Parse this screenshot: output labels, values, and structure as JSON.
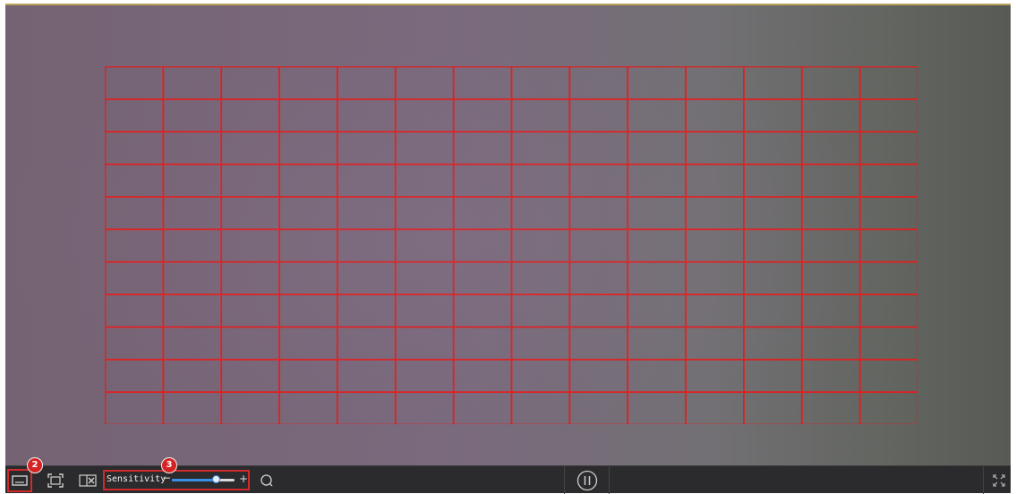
{
  "video": {
    "grid_rows": 11,
    "grid_cols": 14,
    "grid_color": "#e02020"
  },
  "toolbar": {
    "draw_area_tool": {
      "icon": "draw-rectangle-icon",
      "badge": "2"
    },
    "full_screen_area_tool": {
      "icon": "select-all-area-icon"
    },
    "clear_area_tool": {
      "icon": "clear-area-icon"
    },
    "sensitivity": {
      "label": "Sensitivity",
      "minus": "−",
      "plus": "+",
      "value_fraction": 0.7,
      "badge": "3"
    },
    "search_tool": {
      "icon": "search-icon"
    },
    "pause_button": {
      "icon": "pause-icon"
    },
    "fullscreen_button": {
      "icon": "fullscreen-icon"
    }
  },
  "colors": {
    "highlight": "#d02a2a",
    "badge": "#d62222",
    "slider_accent": "#3a8ee6",
    "toolbar_bg": "#2b2b2d"
  }
}
